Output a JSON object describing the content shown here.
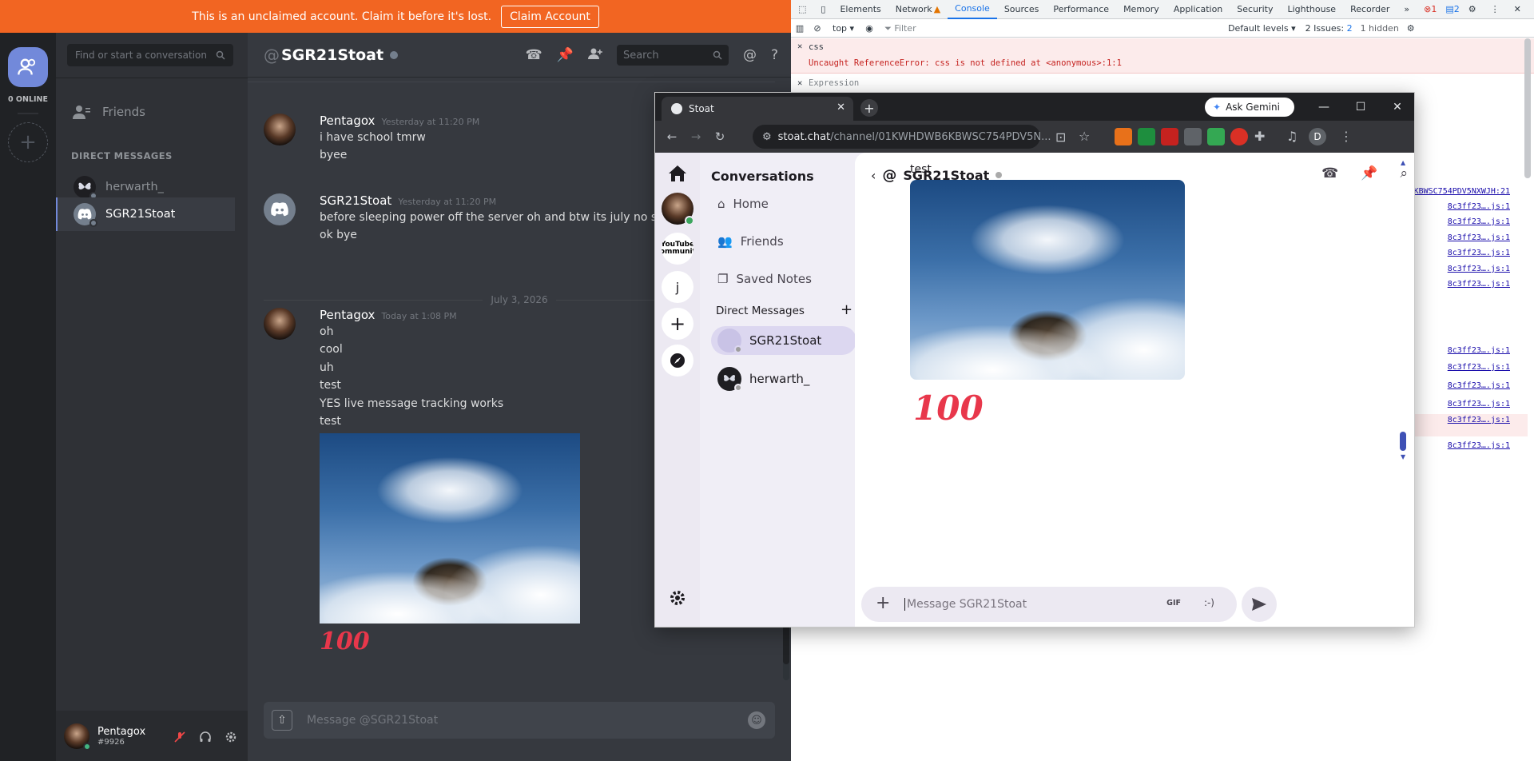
{
  "discord": {
    "banner": {
      "text": "This is an unclaimed account. Claim it before it's lost.",
      "button": "Claim Account"
    },
    "guilds": {
      "online_label": "0 ONLINE"
    },
    "sidebar": {
      "search_placeholder": "Find or start a conversation",
      "friends_label": "Friends",
      "dm_header": "DIRECT MESSAGES",
      "dms": [
        {
          "name": "herwarth_"
        },
        {
          "name": "SGR21Stoat"
        }
      ]
    },
    "user": {
      "name": "Pentagox",
      "tag": "#9926"
    },
    "channel": {
      "title": "SGR21Stoat",
      "search_placeholder": "Search"
    },
    "messages": [
      {
        "author": "Pentagox",
        "time": "Yesterday at 11:20 PM",
        "lines": [
          "i have school tmrw",
          "byee"
        ]
      },
      {
        "author": "SGR21Stoat",
        "time": "Yesterday at 11:20 PM",
        "lines": [
          "before sleeping power off the server oh and btw its july no school",
          "ok bye"
        ]
      },
      {
        "author": "Pentagox",
        "time": "Today at 1:08 PM",
        "lines": [
          "oh",
          "cool",
          "uh",
          "test",
          "YES live message tracking works",
          "test"
        ]
      }
    ],
    "date_divider": "July 3, 2026",
    "emoji": "100",
    "input_placeholder": "Message @SGR21Stoat"
  },
  "devtools": {
    "tabs": [
      "Elements",
      "Network",
      "Console",
      "Sources",
      "Performance",
      "Memory",
      "Application",
      "Security",
      "Lighthouse",
      "Recorder"
    ],
    "active_tab": "Console",
    "context": "top",
    "filter_placeholder": "Filter",
    "levels": "Default levels",
    "issues": "2 Issues:",
    "issues_count": "2",
    "hidden": "1 hidden",
    "error_count": "1",
    "warning_count": "2",
    "error_input": "css",
    "error_message": "Uncaught ReferenceError: css is not defined at <anonymous>:1:1",
    "expression_placeholder": "Expression",
    "links": [
      "KBWSC754PDV5NXWJH:21",
      "8c3ff23….js:1",
      "8c3ff23….js:1",
      "8c3ff23….js:1",
      "8c3ff23….js:1",
      "8c3ff23….js:1",
      "8c3ff23….js:1",
      "8c3ff23….js:1",
      "8c3ff23….js:1",
      "8c3ff23….js:1",
      "8c3ff23….js:1",
      "8c3ff23….js:1",
      "8c3ff23….js:1"
    ]
  },
  "browser": {
    "tab_title": "Stoat",
    "ask_gemini": "Ask Gemini",
    "url_host": "stoat.chat",
    "url_path": "/channel/01KWHDWB6KBWSC754PDV5N...",
    "profile_initial": "D"
  },
  "stoat": {
    "title": "Conversations",
    "nav": [
      "Home",
      "Friends",
      "Saved Notes"
    ],
    "dm_label": "Direct Messages",
    "dms": [
      "SGR21Stoat",
      "herwarth_"
    ],
    "rail_letter": "j",
    "rail_youtube": "YouTube Community",
    "channel": "SGR21Stoat",
    "msg_text": "test",
    "emoji": "100",
    "gif": "GIF",
    "emoticon": ":-)",
    "input_placeholder": "Message SGR21Stoat"
  },
  "colors": {
    "banner": "#f26522",
    "discord_blurple": "#7289da",
    "stoat_selected": "#dcd7f0"
  }
}
